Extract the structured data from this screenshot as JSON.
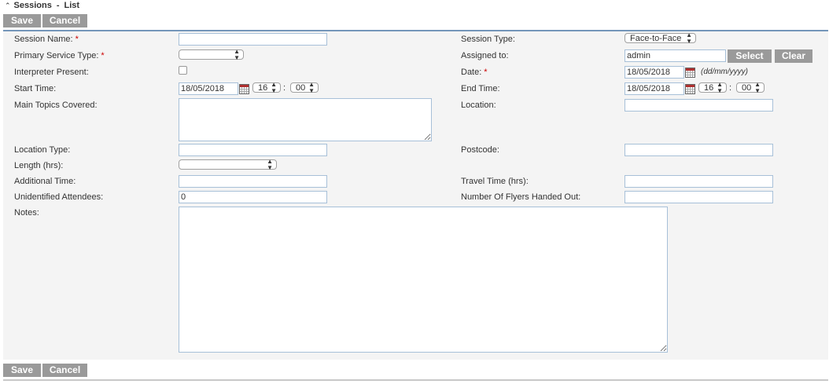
{
  "header": {
    "title": "Sessions",
    "separator": "-",
    "subtitle": "List"
  },
  "toolbar": {
    "save_label": "Save",
    "cancel_label": "Cancel"
  },
  "form": {
    "session_name": {
      "label": "Session Name:",
      "required": "*",
      "value": ""
    },
    "primary_service_type": {
      "label": "Primary Service Type:",
      "required": "*",
      "value": ""
    },
    "interpreter_present": {
      "label": "Interpreter Present:"
    },
    "start_time": {
      "label": "Start Time:",
      "date": "18/05/2018",
      "hour": "16",
      "colon": ":",
      "minute": "00"
    },
    "main_topics": {
      "label": "Main Topics Covered:"
    },
    "location_type": {
      "label": "Location Type:",
      "value": ""
    },
    "length_hrs": {
      "label": "Length (hrs):",
      "value": ""
    },
    "additional_time": {
      "label": "Additional Time:",
      "value": ""
    },
    "unidentified_attendees": {
      "label": "Unidentified Attendees:",
      "value": "0"
    },
    "notes": {
      "label": "Notes:"
    },
    "session_type": {
      "label": "Session Type:",
      "value": "Face-to-Face"
    },
    "assigned_to": {
      "label": "Assigned to:",
      "value": "admin",
      "select_label": "Select",
      "clear_label": "Clear"
    },
    "date": {
      "label": "Date:",
      "required": "*",
      "value": "18/05/2018",
      "format_hint": "(dd/mm/yyyy)"
    },
    "end_time": {
      "label": "End Time:",
      "date": "18/05/2018",
      "hour": "16",
      "colon": ":",
      "minute": "00"
    },
    "location": {
      "label": "Location:",
      "value": ""
    },
    "postcode": {
      "label": "Postcode:",
      "value": ""
    },
    "travel_time": {
      "label": "Travel Time (hrs):",
      "value": ""
    },
    "flyers": {
      "label": "Number Of Flyers Handed Out:",
      "value": ""
    }
  },
  "icons": {
    "collapse": "chevron-up-double-icon",
    "calendar": "calendar-icon",
    "dropdown": "updown-arrow-icon"
  },
  "colors": {
    "button_bg": "#9a9a9a",
    "panel_bg": "#f4f4f4",
    "panel_border": "#7496b9",
    "input_border": "#a7c0d8",
    "required": "#cc0000"
  }
}
